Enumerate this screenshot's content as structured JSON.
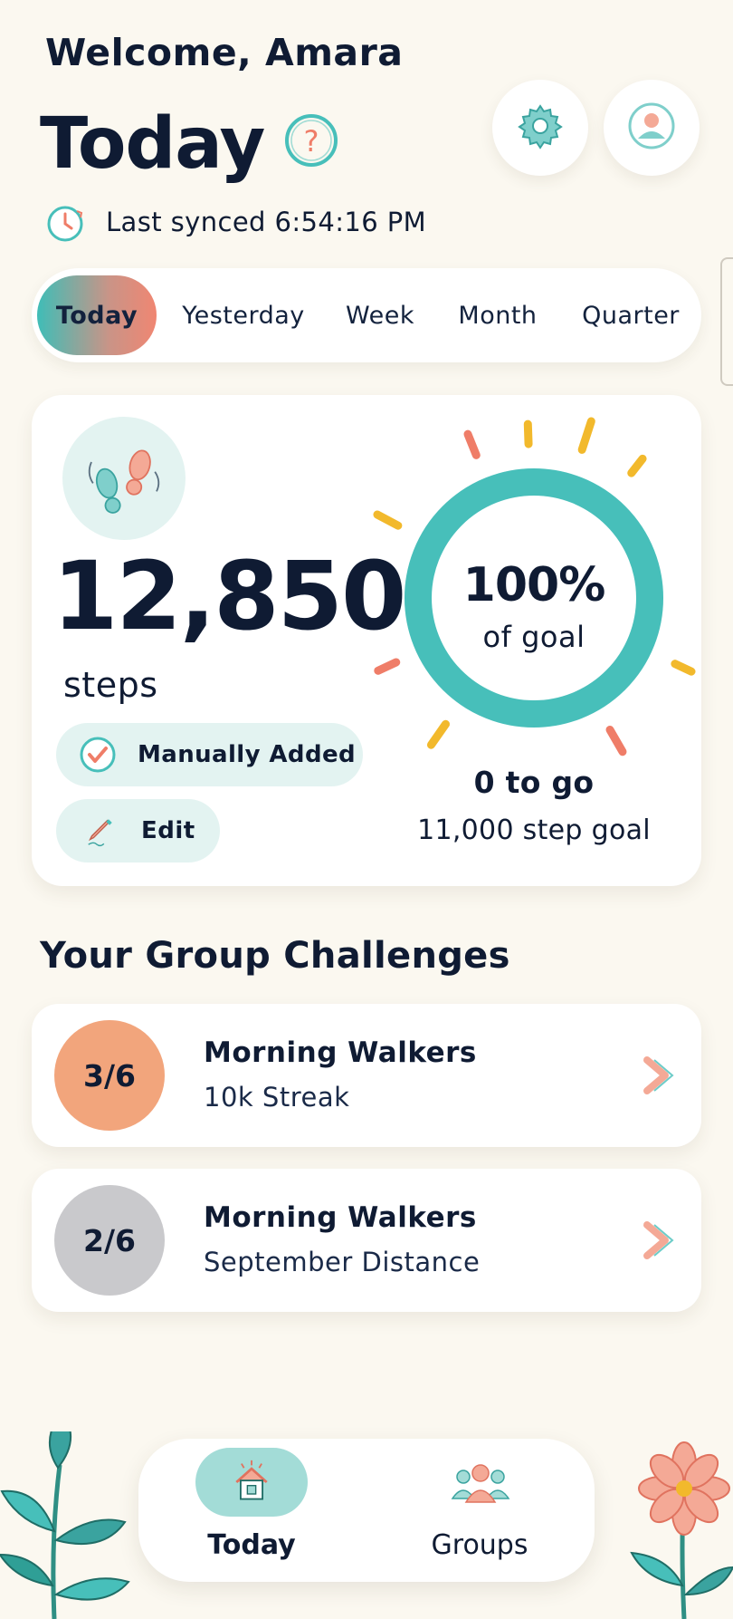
{
  "header": {
    "welcome": "Welcome, Amara",
    "title": "Today",
    "last_synced": "Last synced 6:54:16 PM"
  },
  "range_tabs": [
    {
      "label": "Today",
      "active": true
    },
    {
      "label": "Yesterday",
      "active": false
    },
    {
      "label": "Week",
      "active": false
    },
    {
      "label": "Month",
      "active": false
    },
    {
      "label": "Quarter",
      "active": false
    }
  ],
  "steps": {
    "count": "12,850",
    "unit": "steps",
    "manual_label": "Manually Added",
    "edit_label": "Edit",
    "goal_percent": "100%",
    "goal_percent_value": 1.0,
    "goal_sub": "of goal",
    "to_go": "0 to go",
    "goal_label": "11,000 step goal"
  },
  "challenges": {
    "heading": "Your Group Challenges",
    "items": [
      {
        "rank": "3/6",
        "name": "Morning Walkers",
        "subtitle": "10k Streak",
        "rank_color": "#f2a57c"
      },
      {
        "rank": "2/6",
        "name": "Morning Walkers",
        "subtitle": "September Distance",
        "rank_color": "#c9c9cc"
      }
    ]
  },
  "nav": {
    "today_label": "Today",
    "groups_label": "Groups"
  },
  "colors": {
    "teal": "#47bfba",
    "coral": "#f08672",
    "yellow": "#f2b92c",
    "ink": "#0f1b33",
    "background": "#fbf8f0"
  },
  "icons": {
    "help": "question-circle-icon",
    "settings": "gear-icon",
    "profile": "user-avatar-icon",
    "sync": "clock-icon",
    "feet": "footprints-icon",
    "manual": "check-circle-icon",
    "edit": "pencil-icon",
    "chevron": "chevron-right-icon",
    "nav_today": "home-icon",
    "nav_groups": "group-icon"
  }
}
